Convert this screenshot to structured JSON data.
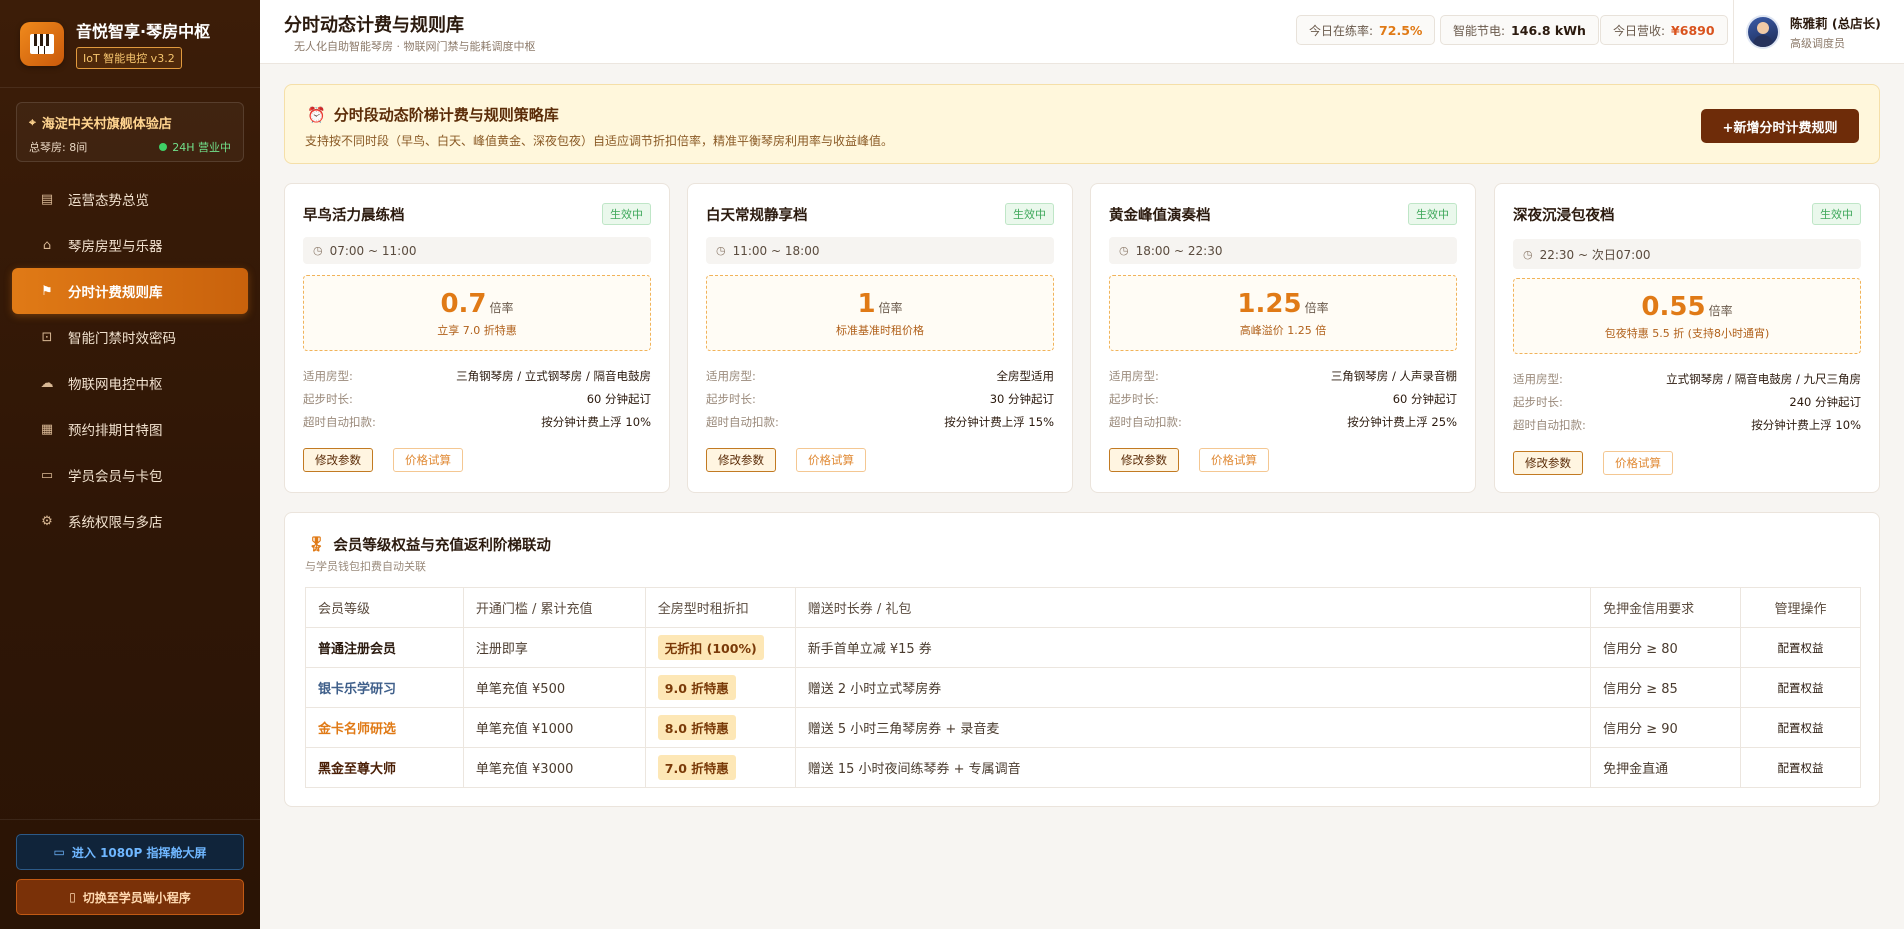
{
  "brand": {
    "title": "音悦智享·琴房中枢",
    "tag": "IoT 智能电控 v3.2"
  },
  "store": {
    "name": "海淀中关村旗舰体验店",
    "rooms": "总琴房: 8间",
    "status": "24H 营业中"
  },
  "nav": [
    {
      "label": "运营态势总览",
      "icon": "chart-icon"
    },
    {
      "label": "琴房房型与乐器",
      "icon": "home-icon"
    },
    {
      "label": "分时计费规则库",
      "icon": "pricing-icon",
      "active": true
    },
    {
      "label": "智能门禁时效密码",
      "icon": "lock-icon"
    },
    {
      "label": "物联网电控中枢",
      "icon": "cloud-icon"
    },
    {
      "label": "预约排期甘特图",
      "icon": "calendar-icon"
    },
    {
      "label": "学员会员与卡包",
      "icon": "folder-icon"
    },
    {
      "label": "系统权限与多店",
      "icon": "gear-icon"
    }
  ],
  "side_buttons": {
    "dashboard": "进入 1080P 指挥舱大屏",
    "miniapp": "切换至学员端小程序"
  },
  "header": {
    "title": "分时动态计费与规则库",
    "subtitle": "无人化自助智能琴房 · 物联网门禁与能耗调度中枢",
    "stats": [
      {
        "label": "今日在练率:",
        "value": "72.5%"
      },
      {
        "label": "智能节电:",
        "value": "146.8 kWh"
      },
      {
        "label": "今日营收:",
        "value": "¥6890"
      }
    ],
    "user": {
      "name": "陈雅莉 (总店长)",
      "role": "高级调度员"
    }
  },
  "banner": {
    "title": "分时段动态阶梯计费与规则策略库",
    "desc": "支持按不同时段（早鸟、白天、峰值黄金、深夜包夜）自适应调节折扣倍率，精准平衡琴房利用率与收益峰值。",
    "add_button": "+新增分时计费规则"
  },
  "card_labels": {
    "room_type": "适用房型:",
    "min_duration": "起步时长:",
    "overtime": "超时自动扣款:",
    "edit": "修改参数",
    "calc": "价格试算",
    "rate_unit": "倍率"
  },
  "cards": [
    {
      "title": "早鸟活力晨练档",
      "status": "生效中",
      "time": "07:00 ~ 11:00",
      "rate": "0.7",
      "note": "立享 7.0 折特惠",
      "room_type": "三角钢琴房 / 立式钢琴房 / 隔音电鼓房",
      "min_duration": "60 分钟起订",
      "overtime": "按分钟计费上浮 10%"
    },
    {
      "title": "白天常规静享档",
      "status": "生效中",
      "time": "11:00 ~ 18:00",
      "rate": "1",
      "note": "标准基准时租价格",
      "room_type": "全房型适用",
      "min_duration": "30 分钟起订",
      "overtime": "按分钟计费上浮 15%"
    },
    {
      "title": "黄金峰值演奏档",
      "status": "生效中",
      "time": "18:00 ~ 22:30",
      "rate": "1.25",
      "note": "高峰溢价 1.25 倍",
      "room_type": "三角钢琴房 / 人声录音棚",
      "min_duration": "60 分钟起订",
      "overtime": "按分钟计费上浮 25%"
    },
    {
      "title": "深夜沉浸包夜档",
      "status": "生效中",
      "time": "22:30 ~ 次日07:00",
      "rate": "0.55",
      "note": "包夜特惠 5.5 折 (支持8小时通宵)",
      "room_type": "立式钢琴房 / 隔音电鼓房 / 九尺三角房",
      "min_duration": "240 分钟起订",
      "overtime": "按分钟计费上浮 10%"
    }
  ],
  "member": {
    "title": "会员等级权益与充值返利阶梯联动",
    "subtitle": "与学员钱包扣费自动关联",
    "columns": [
      "会员等级",
      "开通门槛 / 累计充值",
      "全房型时租折扣",
      "赠送时长券 / 礼包",
      "免押金信用要求",
      "管理操作"
    ],
    "rows": [
      {
        "level": "普通注册会员",
        "color": "#2b1a0e",
        "threshold": "注册即享",
        "discount": "无折扣 (100%)",
        "gift": "新手首单立减 ¥15 券",
        "credit": "信用分 ≥ 80",
        "action": "配置权益"
      },
      {
        "level": "银卡乐学研习",
        "color": "#3f5f8a",
        "threshold": "单笔充值 ¥500",
        "discount": "9.0 折特惠",
        "gift": "赠送 2 小时立式琴房券",
        "credit": "信用分 ≥ 85",
        "action": "配置权益"
      },
      {
        "level": "金卡名师研选",
        "color": "#e07a16",
        "threshold": "单笔充值 ¥1000",
        "discount": "8.0 折特惠",
        "gift": "赠送 5 小时三角琴房券 + 录音麦",
        "credit": "信用分 ≥ 90",
        "action": "配置权益"
      },
      {
        "level": "黑金至尊大师",
        "color": "#4a1f06",
        "threshold": "单笔充值 ¥3000",
        "discount": "7.0 折特惠",
        "gift": "赠送 15 小时夜间练琴券 + 专属调音",
        "credit": "免押金直通",
        "action": "配置权益"
      }
    ]
  }
}
